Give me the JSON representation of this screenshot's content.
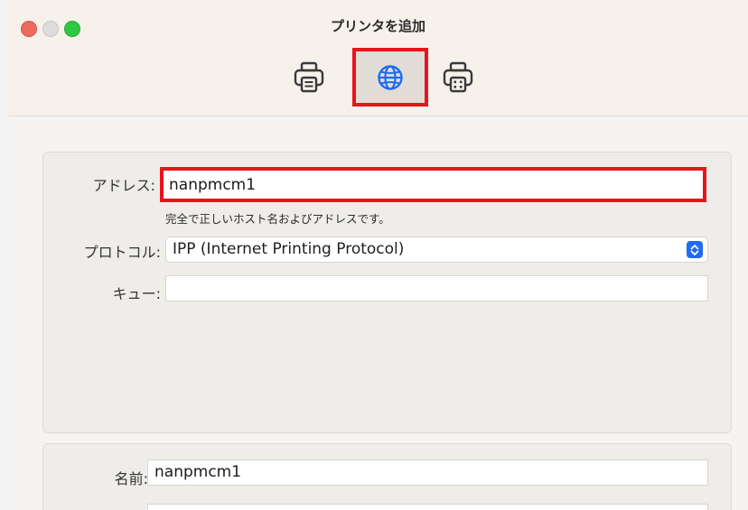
{
  "window": {
    "title": "プリンタを追加"
  },
  "toolbar": {
    "items": [
      {
        "icon": "printer-icon",
        "selected": false
      },
      {
        "icon": "globe-icon",
        "selected": true
      },
      {
        "icon": "windows-printer-icon",
        "selected": false
      }
    ]
  },
  "form": {
    "address_label": "アドレス:",
    "address_value": "nanpmcm1",
    "address_hint": "完全で正しいホスト名およびアドレスです。",
    "protocol_label": "プロトコル:",
    "protocol_value": "IPP (Internet Printing Protocol)",
    "queue_label": "キュー:",
    "queue_value": ""
  },
  "details": {
    "name_label": "名前:",
    "name_value": "nanpmcm1"
  },
  "colors": {
    "accent": "#1e6cf3",
    "highlight": "#e8141a"
  }
}
